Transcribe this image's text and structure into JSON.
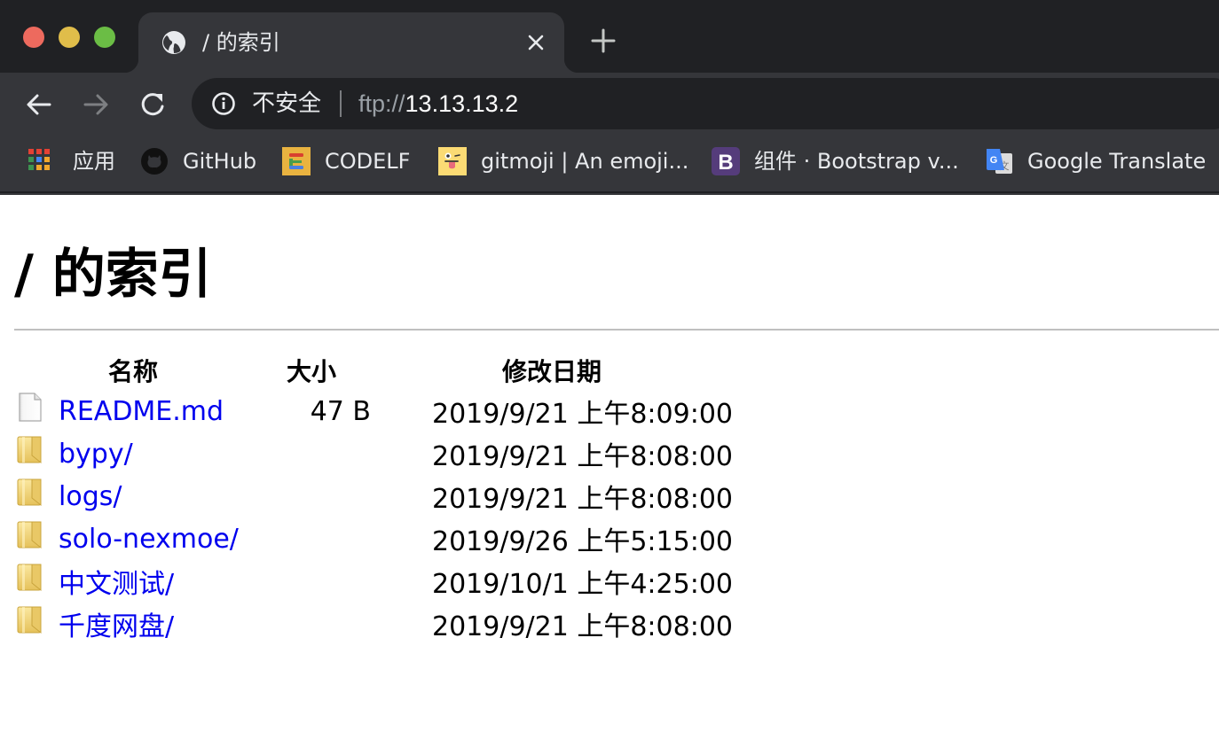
{
  "window": {
    "controls": [
      "close",
      "minimize",
      "maximize"
    ]
  },
  "tab": {
    "favicon": "globe-icon",
    "title": "/ 的索引",
    "close_icon": "close-icon"
  },
  "new_tab_icon": "plus-icon",
  "toolbar": {
    "back_icon": "arrow-left-icon",
    "forward_icon": "arrow-right-icon",
    "reload_icon": "reload-icon",
    "security_icon": "info-icon",
    "security_label": "不安全",
    "url_scheme": "ftp://",
    "url_host": "13.13.13.2"
  },
  "bookmarks": [
    {
      "label": "应用",
      "icon": "apps-grid-icon"
    },
    {
      "label": "GitHub",
      "icon": "github-icon"
    },
    {
      "label": "CODELF",
      "icon": "codelf-icon"
    },
    {
      "label": "gitmoji | An emoji...",
      "icon": "gitmoji-icon"
    },
    {
      "label": "组件 · Bootstrap v...",
      "icon": "bootstrap-icon"
    },
    {
      "label": "Google Translate",
      "icon": "google-translate-icon"
    }
  ],
  "page": {
    "heading": "/ 的索引",
    "columns": {
      "name": "名称",
      "size": "大小",
      "modified": "修改日期"
    },
    "entries": [
      {
        "name": "README.md",
        "type": "file",
        "size": "47 B",
        "modified": "2019/9/21 上午8:09:00"
      },
      {
        "name": "bypy/",
        "type": "folder",
        "size": "",
        "modified": "2019/9/21 上午8:08:00"
      },
      {
        "name": "logs/",
        "type": "folder",
        "size": "",
        "modified": "2019/9/21 上午8:08:00"
      },
      {
        "name": "solo-nexmoe/",
        "type": "folder",
        "size": "",
        "modified": "2019/9/26 上午5:15:00"
      },
      {
        "name": "中文测试/",
        "type": "folder",
        "size": "",
        "modified": "2019/10/1 上午4:25:00"
      },
      {
        "name": "千度网盘/",
        "type": "folder",
        "size": "",
        "modified": "2019/9/21 上午8:08:00"
      }
    ]
  },
  "colors": {
    "link": "#0000ee",
    "chrome_bg": "#35363a",
    "tabstrip_bg": "#202124",
    "text_light": "#e8eaed"
  }
}
